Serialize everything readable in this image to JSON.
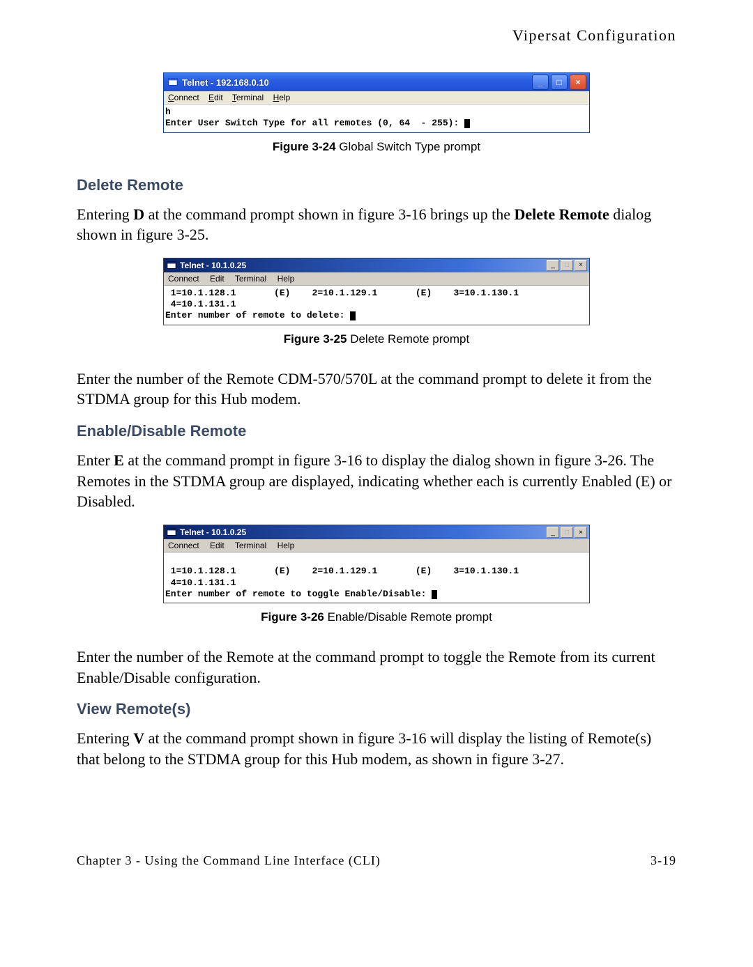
{
  "page_header": "Vipersat Configuration",
  "fig24": {
    "win_title": "Telnet - 192.168.0.10",
    "menu": {
      "c": "Connect",
      "e": "Edit",
      "t": "Terminal",
      "h": "Help"
    },
    "line1": "h",
    "line2": "Enter User Switch Type for all remotes (0, 64  - 255): ",
    "caption_label": "Figure 3-24",
    "caption_text": "  Global Switch Type prompt"
  },
  "delete_remote": {
    "title": "Delete Remote",
    "para": "Entering D at the command prompt shown in figure 3-16 brings up the Delete Remote dialog shown in figure 3-25."
  },
  "fig25": {
    "win_title": "Telnet - 10.1.0.25",
    "menu": {
      "c": "Connect",
      "e": "Edit",
      "t": "Terminal",
      "h": "Help"
    },
    "line1": " 1=10.1.128.1       (E)    2=10.1.129.1       (E)    3=10.1.130.1",
    "line2": " 4=10.1.131.1",
    "line3": "Enter number of remote to delete: ",
    "caption_label": "Figure 3-25",
    "caption_text": "  Delete Remote prompt"
  },
  "delete_remote_after": "Enter the number of the Remote CDM-570/570L at the command prompt to delete it from the STDMA group for this Hub modem.",
  "enable_remote": {
    "title": "Enable/Disable Remote",
    "para": "Enter E at the command prompt in figure 3-16 to display the dialog shown in figure 3-26. The Remotes in the STDMA group are displayed, indicating whether each  is currently Enabled (E) or Disabled."
  },
  "fig26": {
    "win_title": "Telnet - 10.1.0.25",
    "menu": {
      "c": "Connect",
      "e": "Edit",
      "t": "Terminal",
      "h": "Help"
    },
    "line1": " 1=10.1.128.1       (E)    2=10.1.129.1       (E)    3=10.1.130.1",
    "line2": " 4=10.1.131.1",
    "line3": "Enter number of remote to toggle Enable/Disable: ",
    "caption_label": "Figure 3-26",
    "caption_text": "  Enable/Disable Remote prompt"
  },
  "enable_remote_after": "Enter the number of the Remote at the command prompt to toggle the Remote from its current Enable/Disable configuration.",
  "view_remotes": {
    "title": "View Remote(s)",
    "para": "Entering V at the command prompt shown in figure 3-16 will display the listing of Remote(s) that belong to the STDMA group for this Hub modem, as shown in figure 3-27."
  },
  "footer": {
    "left": "Chapter 3 - Using the Command Line Interface (CLI)",
    "right": "3-19"
  }
}
